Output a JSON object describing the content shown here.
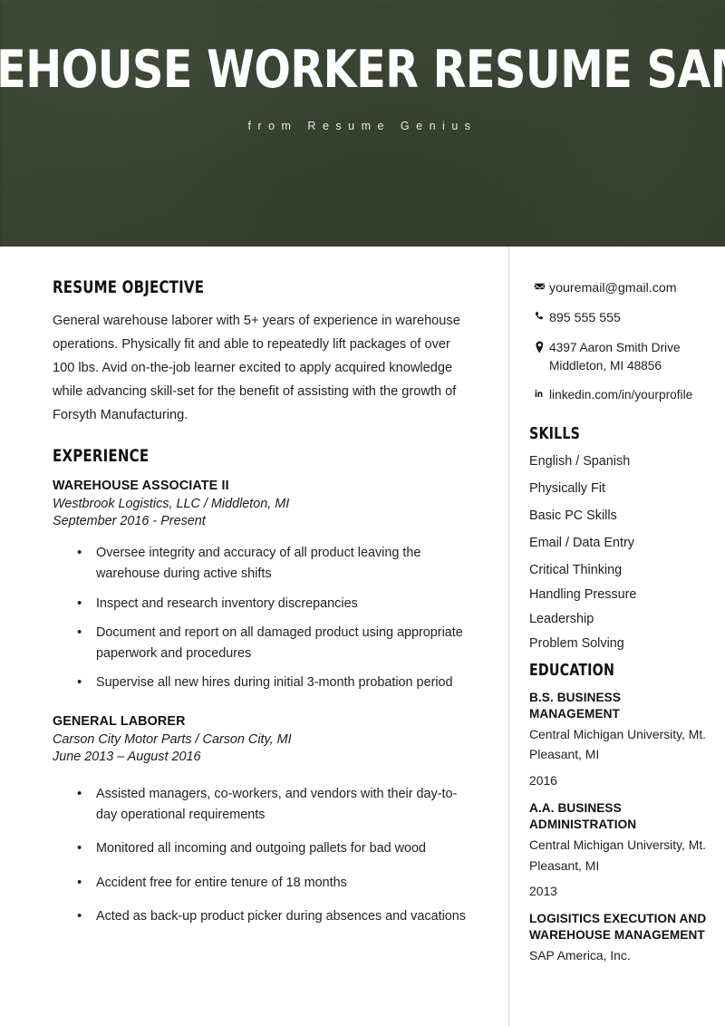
{
  "header": {
    "title": "WAREHOUSE WORKER RESUME SAMPLE",
    "subtitle": "from Resume Genius",
    "overlay_color": "#38412f",
    "title_color": "#ffffff"
  },
  "left": {
    "objective": {
      "heading": "RESUME OBJECTIVE",
      "text": "General warehouse laborer with 5+ years of experience in warehouse operations. Physically fit and able to repeatedly lift packages of over 100 lbs. Avid on-the-job learner excited to apply acquired knowledge while advancing skill-set for the benefit of assisting with the growth of Forsyth Manufacturing."
    },
    "experience": {
      "heading": "EXPERIENCE",
      "jobs": [
        {
          "title": "WAREHOUSE ASSOCIATE II",
          "company": "Westbrook Logistics, LLC",
          "separator": "/",
          "location": "Middleton, MI",
          "dates": "September 2016 - Present",
          "bullets": [
            "Oversee integrity and accuracy of all product leaving the warehouse during active shifts",
            "Inspect and research inventory discrepancies",
            "Document and report on all damaged product using appropriate paperwork and procedures",
            "Supervise all new hires during initial 3-month probation period"
          ]
        },
        {
          "title": "GENERAL LABORER",
          "company": "Carson City Motor Parts",
          "separator": "/",
          "location": "Carson City, MI",
          "dates": "June 2013 – August 2016",
          "bullets": [
            "Assisted managers, co-workers, and vendors with their day-to-day operational requirements",
            "Monitored all incoming and outgoing pallets for bad wood",
            "Accident free for entire tenure of 18 months",
            "Acted as back-up product picker during absences and vacations"
          ]
        }
      ]
    }
  },
  "right": {
    "contact": [
      {
        "icon": "envelope-icon",
        "text": "youremail@gmail.com"
      },
      {
        "icon": "phone-icon",
        "text": "895 555 555"
      },
      {
        "icon": "map-pin-icon",
        "text": "4397 Aaron Smith Drive Middleton, MI 48856"
      },
      {
        "icon": "linkedin-icon",
        "text": "linkedin.com/in/yourprofile"
      }
    ],
    "skills": {
      "heading": "SKILLS",
      "items": [
        "English / Spanish",
        "Physically Fit",
        "Basic PC Skills",
        "Email / Data Entry",
        "Critical Thinking",
        "Handling Pressure",
        "Leadership",
        "Problem Solving"
      ]
    },
    "education": {
      "heading": "EDUCATION",
      "entries": [
        {
          "degree": "B.S. BUSINESS MANAGEMENT",
          "school": "Central Michigan University, Mt. Pleasant, MI",
          "year": "2016"
        },
        {
          "degree": "A.A. BUSINESS ADMINISTRATION",
          "school": "Central Michigan University, Mt. Pleasant, MI",
          "year": "2013"
        },
        {
          "degree": "LOGISITICS EXECUTION AND WAREHOUSE MANAGEMENT",
          "school": "SAP America, Inc.",
          "year": ""
        }
      ]
    }
  }
}
